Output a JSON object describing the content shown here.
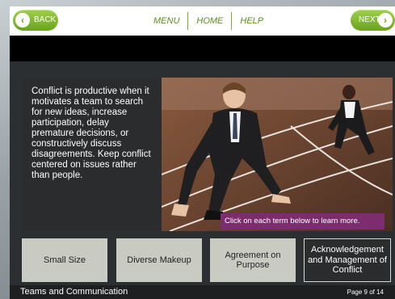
{
  "nav": {
    "back_label": "BACK",
    "next_label": "NEXT",
    "links": [
      "MENU",
      "HOME",
      "HELP"
    ]
  },
  "content": {
    "intro_text": "Conflict is productive when it motivates a team to search for new ideas, increase participation, delay premature decisions, or constructively discuss disagreements. Keep conflict centered on issues rather than people.",
    "caption": "Click on each term below to learn more."
  },
  "terms": [
    {
      "label": "Small Size",
      "active": false
    },
    {
      "label": "Diverse Makeup",
      "active": false
    },
    {
      "label": "Agreement on Purpose",
      "active": false
    },
    {
      "label": "Acknowledgement and Management of Conflict",
      "active": true
    }
  ],
  "footer": {
    "title": "Teams and Communication",
    "page": "Page 9 of 14"
  },
  "colors": {
    "accent_green": "#6aa31e",
    "caption_bg": "#7b2d6e"
  }
}
